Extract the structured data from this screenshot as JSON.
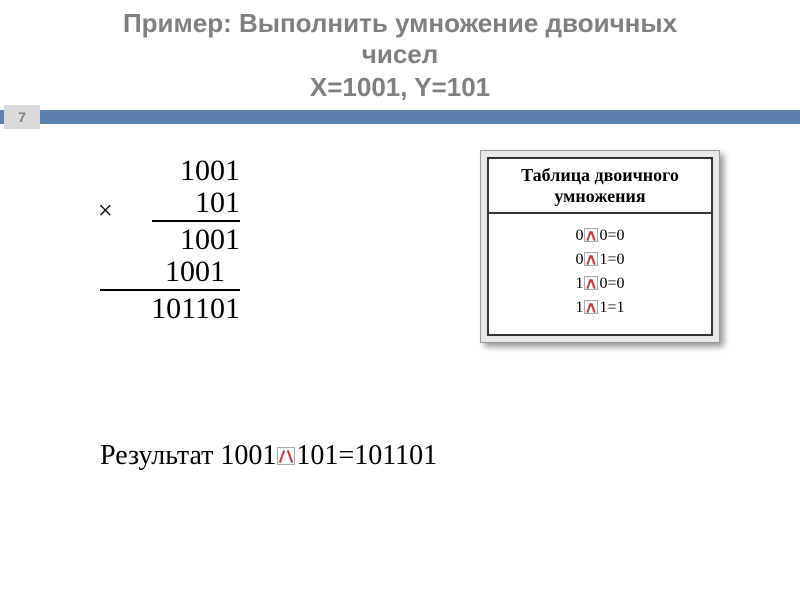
{
  "page_number": "7",
  "title": {
    "prefix": "Пример",
    "line1_rest": ": Выполнить умножение двоичных",
    "line2": "чисел",
    "line3": "X=1001, Y=101"
  },
  "multiplication": {
    "multiplicand": "1001",
    "multiplier": "101",
    "partial1": "1001",
    "partial2": "1001",
    "product": "101101",
    "sign": "×"
  },
  "table": {
    "header_l1": "Таблица двоичного",
    "header_l2": "умножения",
    "rows": [
      {
        "a": "0",
        "b": "0",
        "r": "0"
      },
      {
        "a": "0",
        "b": "1",
        "r": "0"
      },
      {
        "a": "1",
        "b": "0",
        "r": "0"
      },
      {
        "a": "1",
        "b": "1",
        "r": "1"
      }
    ]
  },
  "result": {
    "label": "Результат",
    "lhs": "1001",
    "rhs": "101",
    "eq": "=",
    "value": "101101"
  }
}
